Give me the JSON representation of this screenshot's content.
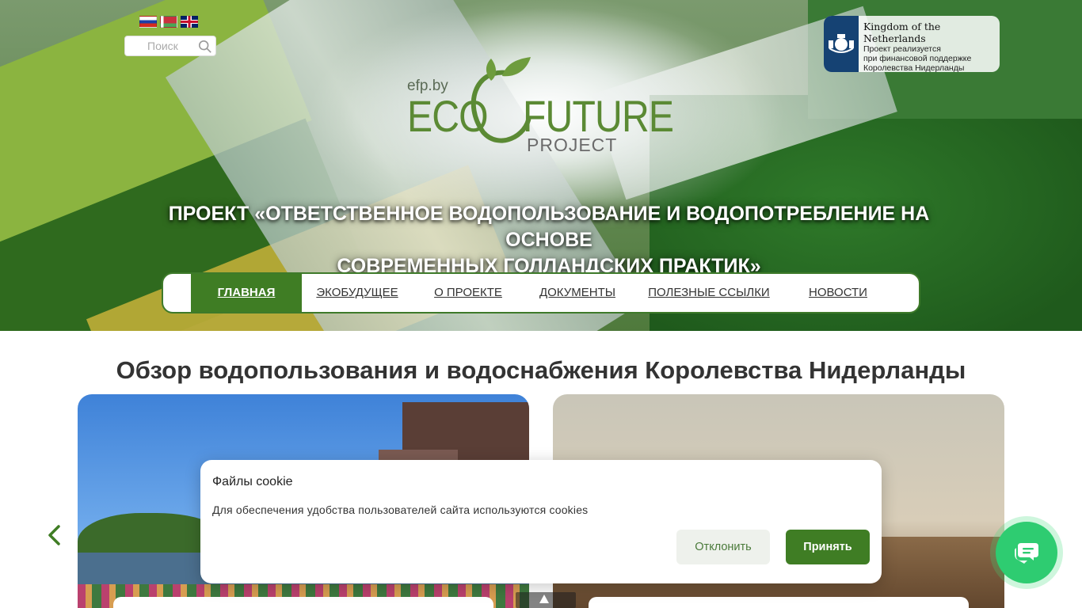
{
  "header": {
    "languages": [
      {
        "code": "ru",
        "icon": "flag-russia-icon"
      },
      {
        "code": "by",
        "icon": "flag-belarus-icon"
      },
      {
        "code": "en",
        "icon": "flag-uk-icon"
      }
    ],
    "search": {
      "placeholder": "Поиск",
      "icon": "search-icon"
    },
    "logo": {
      "domain": "efp.by",
      "eco": "ECO",
      "future": "FUTURE",
      "project": "PROJECT"
    },
    "kingdom": {
      "name": "Kingdom of the Netherlands",
      "lines": [
        "Проект реализуется",
        "при финансовой поддержке",
        "Королевства Нидерланды"
      ]
    },
    "headline_line1": "ПРОЕКТ «ОТВЕТСТВЕННОЕ ВОДОПОЛЬЗОВАНИЕ И ВОДОПОТРЕБЛЕНИЕ НА ОСНОВЕ",
    "headline_line2": "СОВРЕМЕННЫХ ГОЛЛАНДСКИХ ПРАКТИК»"
  },
  "nav": {
    "items": [
      {
        "label": "ГЛАВНАЯ",
        "active": true
      },
      {
        "label": "ЭКОБУДУЩЕЕ",
        "active": false
      },
      {
        "label": "О ПРОЕКТЕ",
        "active": false
      },
      {
        "label": "ДОКУМЕНТЫ",
        "active": false
      },
      {
        "label": "ПОЛЕЗНЫЕ ССЫЛКИ",
        "active": false
      },
      {
        "label": "НОВОСТИ",
        "active": false
      }
    ]
  },
  "section": {
    "title": "Обзор водопользования и водоснабжения Королевства Нидерланды"
  },
  "cookie": {
    "title": "Файлы cookie",
    "text": "Для обеспечения удобства пользователей сайта используются cookies",
    "decline_label": "Отклонить",
    "accept_label": "Принять"
  },
  "colors": {
    "brand_green": "#3f7d24",
    "chat_green": "#2ecc71",
    "logo_green": "#5b8a34"
  }
}
